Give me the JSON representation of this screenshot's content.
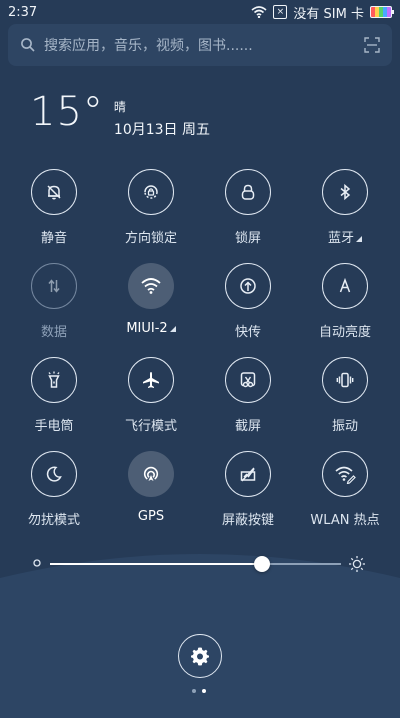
{
  "status_bar": {
    "time": "2:37",
    "no_sim_text": "没有 SIM 卡",
    "icons": [
      "wifi-icon",
      "sim-disabled-icon",
      "battery-icon"
    ]
  },
  "search": {
    "placeholder": "搜索应用，音乐，视频，图书......",
    "icon": "search-icon",
    "scan_icon": "scan-icon"
  },
  "weather": {
    "temperature": "15°",
    "condition": "晴",
    "date": "10月13日 周五"
  },
  "toggles": [
    {
      "label": "静音",
      "icon": "bell-off-icon",
      "active": false,
      "enabled": true
    },
    {
      "label": "方向锁定",
      "icon": "rotation-lock-icon",
      "active": false,
      "enabled": true
    },
    {
      "label": "锁屏",
      "icon": "lock-icon",
      "active": false,
      "enabled": true
    },
    {
      "label": "蓝牙",
      "icon": "bluetooth-icon",
      "active": false,
      "enabled": true,
      "has_more": true
    },
    {
      "label": "数据",
      "icon": "mobile-data-icon",
      "active": false,
      "enabled": false
    },
    {
      "label": "MIUI-2",
      "icon": "wifi-icon",
      "active": true,
      "enabled": true,
      "has_more": true
    },
    {
      "label": "快传",
      "icon": "fast-transfer-icon",
      "active": false,
      "enabled": true
    },
    {
      "label": "自动亮度",
      "icon": "auto-brightness-icon",
      "active": false,
      "enabled": true
    },
    {
      "label": "手电筒",
      "icon": "flashlight-icon",
      "active": false,
      "enabled": true
    },
    {
      "label": "飞行模式",
      "icon": "airplane-icon",
      "active": false,
      "enabled": true
    },
    {
      "label": "截屏",
      "icon": "screenshot-icon",
      "active": false,
      "enabled": true
    },
    {
      "label": "振动",
      "icon": "vibrate-icon",
      "active": false,
      "enabled": true
    },
    {
      "label": "勿扰模式",
      "icon": "moon-icon",
      "active": false,
      "enabled": true
    },
    {
      "label": "GPS",
      "icon": "gps-icon",
      "active": true,
      "enabled": true
    },
    {
      "label": "屏蔽按键",
      "icon": "block-keys-icon",
      "active": false,
      "enabled": true
    },
    {
      "label": "WLAN 热点",
      "icon": "hotspot-icon",
      "active": false,
      "enabled": true
    }
  ],
  "brightness": {
    "level": 0.73,
    "min_icon": "sun-small-icon",
    "max_icon": "sun-large-icon"
  },
  "footer": {
    "settings_icon": "gear-icon",
    "pages": 2,
    "active_page": 2
  },
  "colors": {
    "background_top": "#263b57",
    "background_bottom_wave": "#2d4564",
    "accent": "#ffffff",
    "text_dim": "#8ea1b8"
  }
}
